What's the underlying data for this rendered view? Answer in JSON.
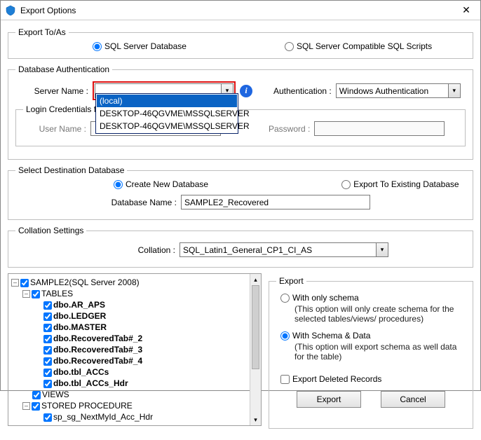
{
  "window": {
    "title": "Export Options"
  },
  "exportToAs": {
    "legend": "Export To/As",
    "opt1": "SQL Server Database",
    "opt2": "SQL Server Compatible SQL Scripts"
  },
  "dbAuth": {
    "legend": "Database Authentication",
    "serverNameLabel": "Server Name :",
    "serverNameValue": "",
    "authLabel": "Authentication :",
    "authValue": "Windows Authentication",
    "dropdown": {
      "opt0": "(local)",
      "opt1": "DESKTOP-46QGVME\\MSSQLSERVER",
      "opt2": "DESKTOP-46QGVME\\MSSQLSERVER"
    },
    "loginLegend": "Login Credentials for selected server",
    "userNameLabel": "User Name :",
    "userNameValue": "",
    "passwordLabel": "Password :",
    "passwordValue": ""
  },
  "destDb": {
    "legend": "Select Destination Database",
    "opt1": "Create New Database",
    "opt2": "Export To Existing Database",
    "dbNameLabel": "Database Name :",
    "dbNameValue": "SAMPLE2_Recovered"
  },
  "collation": {
    "legend": "Collation Settings",
    "label": "Collation :",
    "value": "SQL_Latin1_General_CP1_CI_AS"
  },
  "tree": {
    "root": "SAMPLE2(SQL Server 2008)",
    "tables": "TABLES",
    "t1": "dbo.AR_APS",
    "t2": "dbo.LEDGER",
    "t3": "dbo.MASTER",
    "t4": "dbo.RecoveredTab#_2",
    "t5": "dbo.RecoveredTab#_3",
    "t6": "dbo.RecoveredTab#_4",
    "t7": "dbo.tbl_ACCs",
    "t8": "dbo.tbl_ACCs_Hdr",
    "views": "VIEWS",
    "sp": "STORED PROCEDURE",
    "sp1": "sp_sg_NextMyId_Acc_Hdr"
  },
  "export": {
    "legend": "Export",
    "opt1": "With only schema",
    "opt1desc": "(This option will only create schema for the  selected tables/views/ procedures)",
    "opt2": "With Schema & Data",
    "opt2desc": "(This option will export schema as well data for the table)",
    "deleted": "Export Deleted Records"
  },
  "buttons": {
    "export": "Export",
    "cancel": "Cancel"
  }
}
